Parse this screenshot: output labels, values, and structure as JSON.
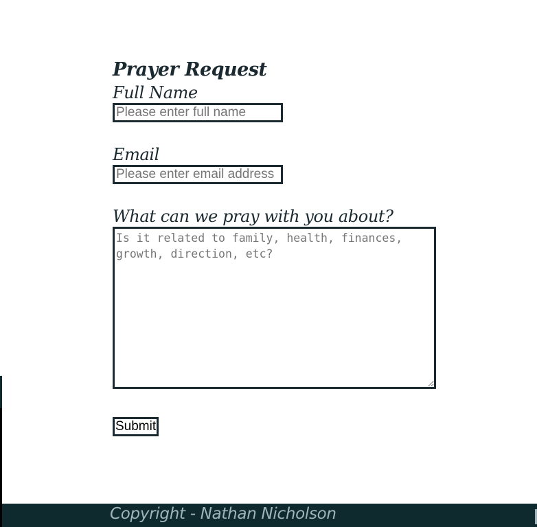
{
  "form": {
    "title": "Prayer Request",
    "full_name": {
      "label": "Full Name",
      "placeholder": "Please enter full name",
      "value": ""
    },
    "email": {
      "label": "Email",
      "placeholder": "Please enter email address",
      "value": ""
    },
    "prayer": {
      "label": "What can we pray with you about?",
      "placeholder": "Is it related to family, health, finances, growth, direction, etc?",
      "value": ""
    },
    "submit_label": "Submit"
  },
  "footer": {
    "copyright": "Copyright - Nathan Nicholson"
  },
  "colors": {
    "primary_dark": "#0f2a2f",
    "text_dark": "#1b2a30",
    "footer_text": "#9fb5bb"
  }
}
